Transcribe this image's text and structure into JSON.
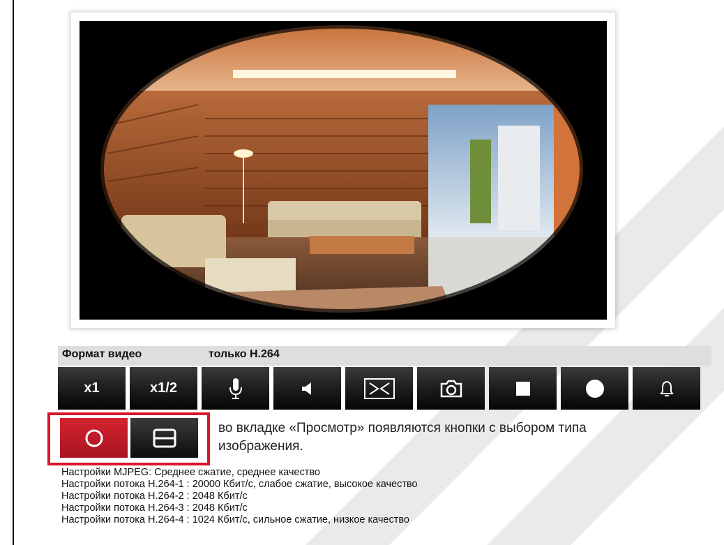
{
  "format": {
    "label": "Формат видео",
    "value": "только H.264"
  },
  "toolbar": {
    "zoom_x1": "x1",
    "zoom_half": "x1/2",
    "buttons": [
      "microphone-icon",
      "speaker-icon",
      "flip-icon",
      "camera-icon",
      "stop-icon",
      "record-icon",
      "alarm-bell-icon"
    ]
  },
  "image_type": {
    "buttons": [
      "circle-view-icon",
      "split-view-icon"
    ]
  },
  "note": "во вкладке «Просмотр» появляются кнопки с выбором типа изображения.",
  "settings": [
    "Настройки MJPEG: Среднее сжатие, среднее качество",
    "Настройки потока H.264-1 : 20000 Кбит/с, слабое сжатие, высокое качество",
    "Настройки потока H.264-2 : 2048 Кбит/с",
    "Настройки потока H.264-3 : 2048 Кбит/с",
    "Настройки потока H.264-4 : 1024 Кбит/с, сильное сжатие, низкое качество"
  ],
  "colors": {
    "accent_red": "#d9162a",
    "button_dark": "#1b1b1b",
    "format_bar": "#dedede"
  }
}
